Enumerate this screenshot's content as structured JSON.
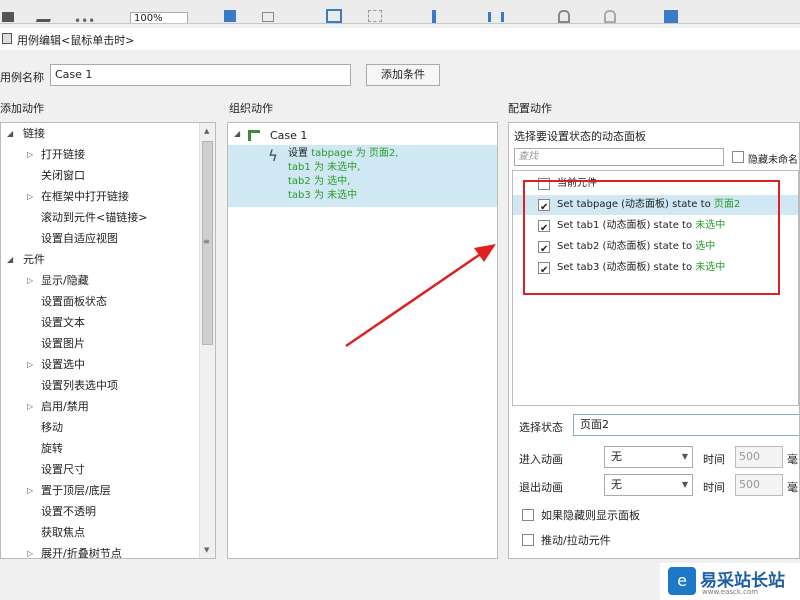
{
  "toolbar": {
    "zoom": "100%",
    "icons": [
      "align-left-icon",
      "draw-icon",
      "more-icon",
      "bring-front-icon",
      "send-back-icon",
      "group-icon",
      "ungroup-icon",
      "align-center-icon",
      "distribute-icon",
      "lock-icon",
      "unlock-icon",
      "fill-icon"
    ]
  },
  "window": {
    "title": "用例编辑<鼠标单击时>"
  },
  "case": {
    "label": "用例名称",
    "value": "Case 1",
    "add_condition": "添加条件"
  },
  "sections": {
    "add_action": "添加动作",
    "organize_action": "组织动作",
    "configure_action": "配置动作"
  },
  "actions_tree": {
    "groups": [
      {
        "label": "链接",
        "items": [
          {
            "label": "打开链接",
            "expandable": true
          },
          {
            "label": "关闭窗口",
            "expandable": false
          },
          {
            "label": "在框架中打开链接",
            "expandable": true
          },
          {
            "label": "滚动到元件<锚链接>",
            "expandable": false
          },
          {
            "label": "设置自适应视图",
            "expandable": false
          }
        ]
      },
      {
        "label": "元件",
        "items": [
          {
            "label": "显示/隐藏",
            "expandable": true
          },
          {
            "label": "设置面板状态",
            "expandable": false
          },
          {
            "label": "设置文本",
            "expandable": false
          },
          {
            "label": "设置图片",
            "expandable": false
          },
          {
            "label": "设置选中",
            "expandable": true
          },
          {
            "label": "设置列表选中项",
            "expandable": false
          },
          {
            "label": "启用/禁用",
            "expandable": true
          },
          {
            "label": "移动",
            "expandable": false
          },
          {
            "label": "旋转",
            "expandable": false
          },
          {
            "label": "设置尺寸",
            "expandable": false
          },
          {
            "label": "置于顶层/底层",
            "expandable": true
          },
          {
            "label": "设置不透明",
            "expandable": false
          },
          {
            "label": "获取焦点",
            "expandable": false
          },
          {
            "label": "展开/折叠树节点",
            "expandable": true
          }
        ]
      }
    ]
  },
  "organize": {
    "case_label": "Case 1",
    "action_lines": [
      {
        "prefix": "设置 ",
        "green": "tabpage 为 页面2,"
      },
      {
        "prefix": "",
        "green": "tab1 为 未选中,"
      },
      {
        "prefix": "",
        "green": "tab2 为 选中,"
      },
      {
        "prefix": "",
        "green": "tab3 为 未选中"
      }
    ]
  },
  "configure": {
    "select_panel_label": "选择要设置状态的动态面板",
    "search_placeholder": "查找",
    "hide_unnamed_label": "隐藏未命名",
    "list": [
      {
        "text": "当前元件",
        "green": "",
        "checked": false,
        "selected": false
      },
      {
        "text": "Set tabpage (动态面板) state to ",
        "green": "页面2",
        "checked": true,
        "selected": true
      },
      {
        "text": "Set tab1 (动态面板) state to ",
        "green": "未选中",
        "checked": true,
        "selected": false
      },
      {
        "text": "Set tab2 (动态面板) state to ",
        "green": "选中",
        "checked": true,
        "selected": false
      },
      {
        "text": "Set tab3 (动态面板) state to ",
        "green": "未选中",
        "checked": true,
        "selected": false
      }
    ],
    "select_state_label": "选择状态",
    "select_state_value": "页面2",
    "enter_anim_label": "进入动画",
    "enter_anim_value": "无",
    "exit_anim_label": "退出动画",
    "exit_anim_value": "无",
    "time_label": "时间",
    "time_value": "500",
    "ms_label": "毫",
    "show_if_hidden_label": "如果隐藏则显示面板",
    "push_pull_label": "推动/拉动元件"
  },
  "watermark": {
    "logo_glyph": "e",
    "text": "易采站长站",
    "sub": "www.easck.com"
  },
  "colors": {
    "selection": "#cfe8f3",
    "green_text": "#2a9b2a",
    "highlight_red": "#e02020"
  }
}
